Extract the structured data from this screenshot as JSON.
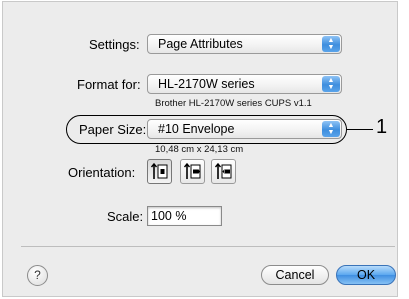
{
  "settings": {
    "label": "Settings:",
    "value": "Page Attributes"
  },
  "format_for": {
    "label": "Format for:",
    "value": "HL-2170W series",
    "description": "Brother HL-2170W series CUPS v1.1"
  },
  "paper_size": {
    "label": "Paper Size:",
    "value": "#10 Envelope",
    "dimensions": "10,48 cm x 24,13 cm"
  },
  "orientation": {
    "label": "Orientation:",
    "options": [
      "portrait",
      "landscape",
      "reverse-landscape"
    ],
    "selected": "portrait"
  },
  "scale": {
    "label": "Scale:",
    "value": "100 %"
  },
  "footer": {
    "help": "?",
    "cancel_label": "Cancel",
    "ok_label": "OK"
  },
  "callout": {
    "number": "1"
  },
  "colors": {
    "accent": "#3f8fe2",
    "window_bg": "#ececec"
  }
}
